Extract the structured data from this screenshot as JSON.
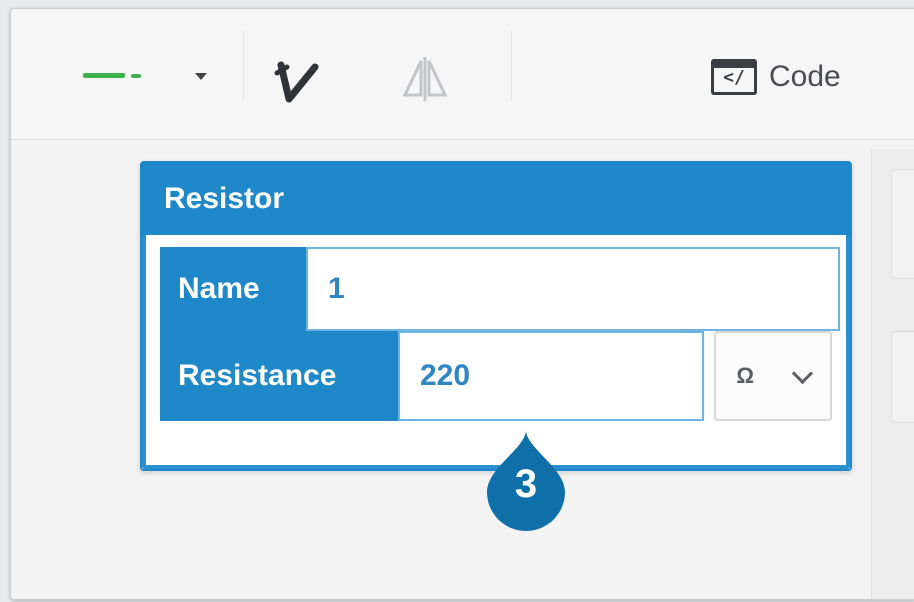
{
  "toolbar": {
    "code_label": "Code",
    "code_icon_glyph": "</"
  },
  "inspector": {
    "title": "Resistor",
    "name_label": "Name",
    "name_value": "1",
    "resistance_label": "Resistance",
    "resistance_value": "220",
    "unit_glyph": "Ω"
  },
  "callout": {
    "number": "3"
  },
  "colors": {
    "accent": "#1e88c9",
    "wire": "#3cb34a",
    "callout": "#0f6fa8"
  }
}
